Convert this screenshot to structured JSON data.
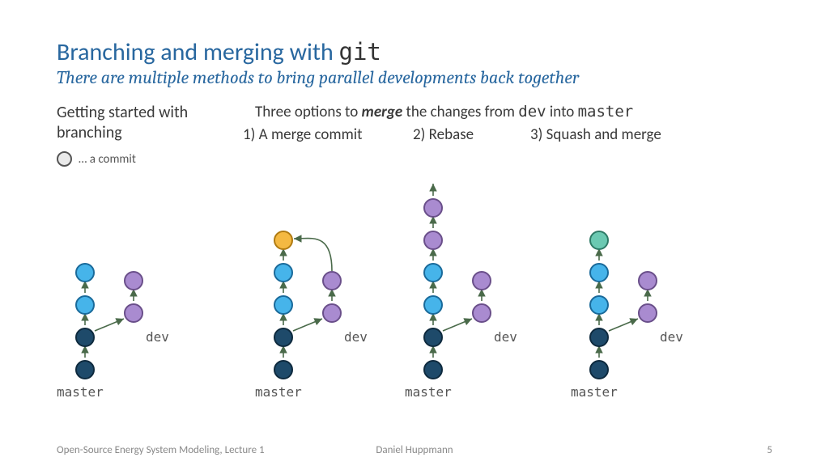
{
  "title_pre": "Branching and merging with ",
  "title_mono": "git",
  "subtitle": "There are multiple methods to bring parallel developments back together",
  "left_heading": "Getting started with branching",
  "legend_text": "… a commit",
  "right_heading_pre": "Three options to ",
  "right_heading_merge": "merge",
  "right_heading_mid": " the changes from ",
  "right_heading_dev": "dev",
  "right_heading_mid2": " into ",
  "right_heading_master": "master",
  "opt1": "1) A merge commit",
  "opt2": "2) Rebase",
  "opt3": "3) Squash and merge",
  "label_master": "master",
  "label_dev": "dev",
  "footer_left": "Open-Source Energy System Modeling, Lecture 1",
  "footer_mid": "Daniel Huppmann",
  "footer_page": "5",
  "colors": {
    "dark": "#1e4a6a",
    "blue": "#46b4ea",
    "purple": "#a98bd0",
    "orange": "#f4b942",
    "teal": "#6bc9b2",
    "arrow": "#4a6a4a",
    "stroke_dark": "#0e2a3e",
    "stroke_blue": "#1a6a9a",
    "stroke_purple": "#6a4f8a",
    "stroke_orange": "#b07b12",
    "stroke_teal": "#2e7a66"
  },
  "chart_data": {
    "type": "diagram",
    "panels": [
      {
        "name": "getting-started",
        "master_nodes": [
          "dark",
          "dark",
          "blue",
          "blue"
        ],
        "dev_nodes": [
          "purple",
          "purple"
        ],
        "dev_branches_from_master_index": 1,
        "result_node": null
      },
      {
        "name": "merge-commit",
        "master_nodes": [
          "dark",
          "dark",
          "blue",
          "blue",
          "orange"
        ],
        "dev_nodes": [
          "purple",
          "purple"
        ],
        "dev_branches_from_master_index": 1,
        "merge_arrow_from_dev_top_to_master_top": true
      },
      {
        "name": "rebase",
        "master_nodes": [
          "dark",
          "dark",
          "blue",
          "blue",
          "purple",
          "purple"
        ],
        "dev_nodes": [
          "purple",
          "purple"
        ],
        "dev_branches_from_master_index": 1
      },
      {
        "name": "squash-merge",
        "master_nodes": [
          "dark",
          "dark",
          "blue",
          "blue",
          "teal"
        ],
        "dev_nodes": [
          "purple",
          "purple"
        ],
        "dev_branches_from_master_index": 1
      }
    ]
  }
}
